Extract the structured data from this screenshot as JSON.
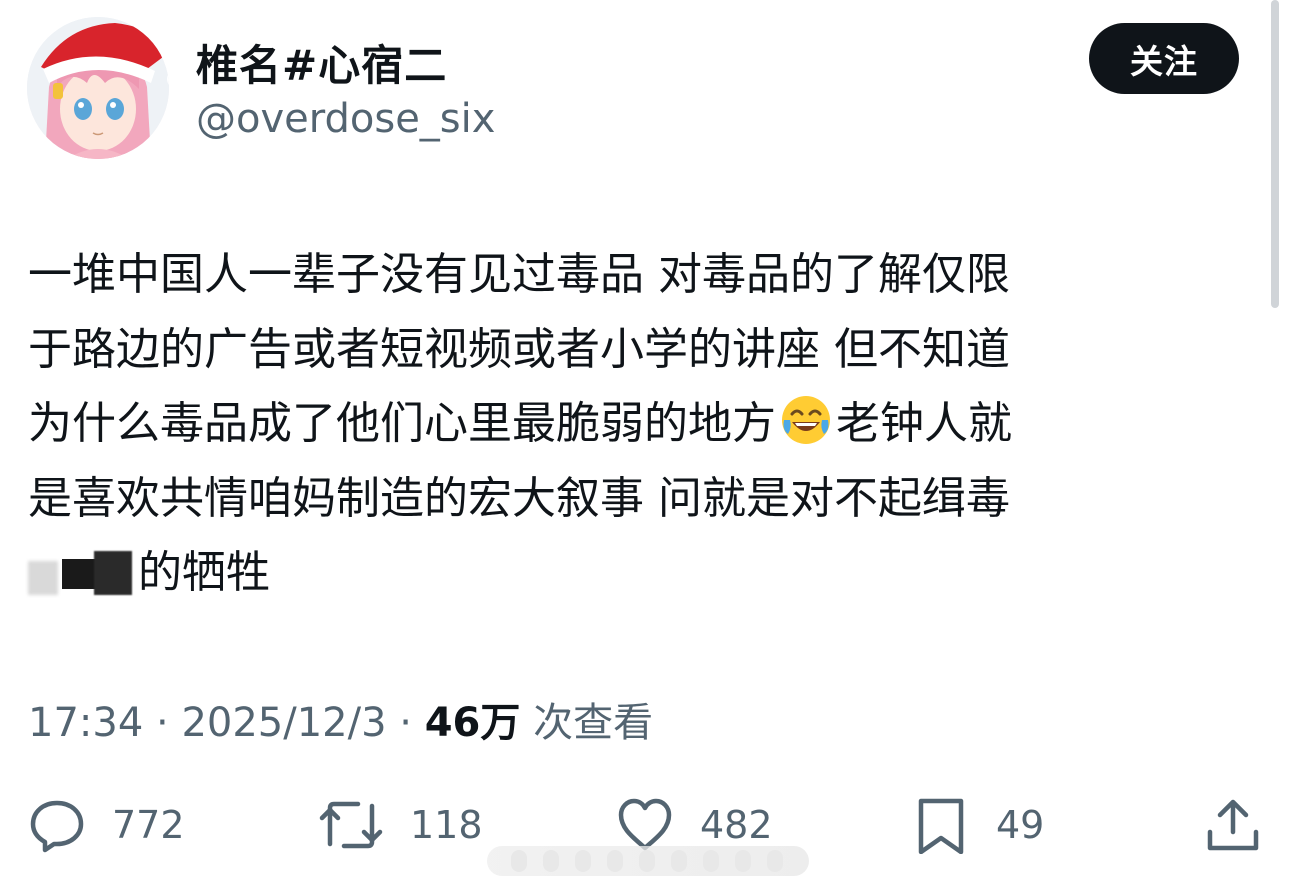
{
  "author": {
    "display_name": "椎名#心宿二",
    "handle": "@overdose_six",
    "avatar": "anime-girl-santa-hat-avatar"
  },
  "follow_label": "关注",
  "tweet": {
    "lines": [
      "一堆中国人一辈子没有见过毒品 对毒品的了解仅限",
      "于路边的广告或者短视频或者小学的讲座 但不知道",
      "为什么毒品成了他们心里最脆弱的地方",
      "老钟人就",
      "是喜欢共情咱妈制造的宏大叙事 问就是对不起缉毒",
      "的牺牲"
    ],
    "emoji": "face-with-tears-of-joy"
  },
  "meta": {
    "time": "17:34",
    "sep": "·",
    "date": "2025/12/3",
    "views": "46万",
    "views_label": "次查看"
  },
  "actions": {
    "reply": "772",
    "retweet": "118",
    "like": "482",
    "bookmark": "49"
  },
  "colors": {
    "text": "#0f1419",
    "secondary": "#536471",
    "button_bg": "#0f1419"
  }
}
